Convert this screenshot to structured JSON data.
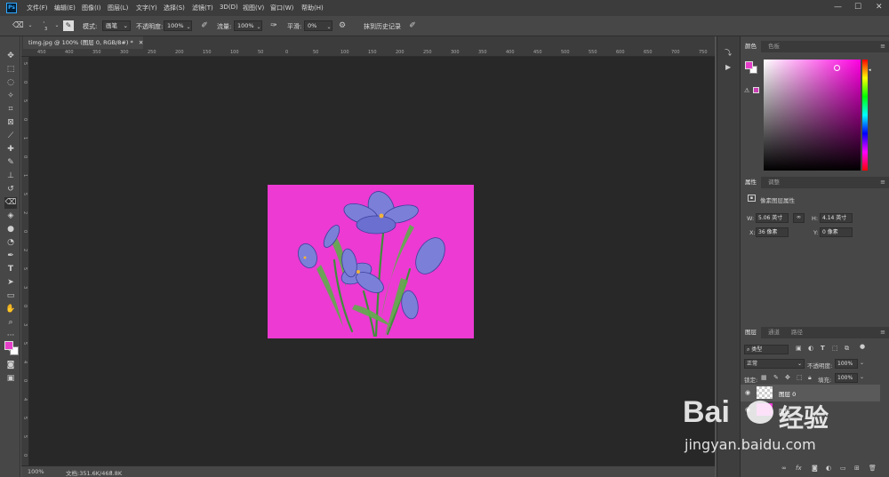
{
  "app": {
    "logo": "Ps"
  },
  "menubar": {
    "items": [
      "文件(F)",
      "编辑(E)",
      "图像(I)",
      "图层(L)",
      "文字(Y)",
      "选择(S)",
      "滤镜(T)",
      "3D(D)",
      "视图(V)",
      "窗口(W)",
      "帮助(H)"
    ],
    "window_buttons": [
      "—",
      "☐",
      "✕"
    ]
  },
  "options": {
    "brush_size": "3",
    "mode_label": "模式:",
    "mode_value": "画笔",
    "opacity_label": "不透明度:",
    "opacity_value": "100%",
    "flow_label": "流量:",
    "flow_value": "100%",
    "smoothing_label": "平滑:",
    "smoothing_value": "0%",
    "erase_history_label": "抹到历史记录"
  },
  "document": {
    "tab_title": "timg.jpg @ 100% (图层 0, RGB/8#) *",
    "close": "✕",
    "zoom": "100%",
    "doc_size": "文档:351.6K/468.8K",
    "ruler_top": [
      "450",
      "400",
      "350",
      "300",
      "250",
      "200",
      "150",
      "100",
      "50",
      "0",
      "50",
      "100",
      "150",
      "200",
      "250",
      "300",
      "350",
      "400",
      "450",
      "500",
      "550",
      "600",
      "650",
      "700",
      "750"
    ],
    "ruler_left": [
      "5",
      "0",
      "5",
      "0",
      "1",
      "0",
      "1",
      "5",
      "2",
      "0",
      "2",
      "5",
      "3",
      "0",
      "3",
      "5",
      "4",
      "0",
      "4",
      "5",
      "5",
      "0"
    ]
  },
  "color_panel": {
    "tabs": [
      "颜色",
      "色板"
    ],
    "foreground": "#e53ec9",
    "background": "#ffffff",
    "hue_color": "#ff00e1"
  },
  "properties_panel": {
    "tabs": [
      "属性",
      "调整"
    ],
    "title": "像素图层属性",
    "w_label": "W:",
    "w_value": "5.06 英寸",
    "h_label": "H:",
    "h_value": "4.14 英寸",
    "x_label": "X:",
    "x_value": "36 像素",
    "y_label": "Y:",
    "y_value": "0 像素"
  },
  "layers_panel": {
    "tabs": [
      "图层",
      "通道",
      "路径"
    ],
    "filter_kind": "类型",
    "blend_mode": "正常",
    "opacity_label": "不透明度:",
    "opacity_value": "100%",
    "lock_label": "锁定:",
    "fill_label": "填充:",
    "fill_value": "100%",
    "layers": [
      {
        "name": "图层 0"
      },
      {
        "name": "图层"
      }
    ],
    "footer_icons": [
      "link-icon",
      "fx-icon",
      "mask-icon",
      "adjustment-icon",
      "group-icon",
      "new-layer-icon",
      "trash-icon"
    ]
  },
  "watermark": {
    "brand": "Bai",
    "brand2": "经验",
    "url": "jingyan.baidu.com"
  },
  "colors": {
    "canvas_bg": "#ec3ad3",
    "workspace": "#282828",
    "accent": "#31a8ff"
  }
}
